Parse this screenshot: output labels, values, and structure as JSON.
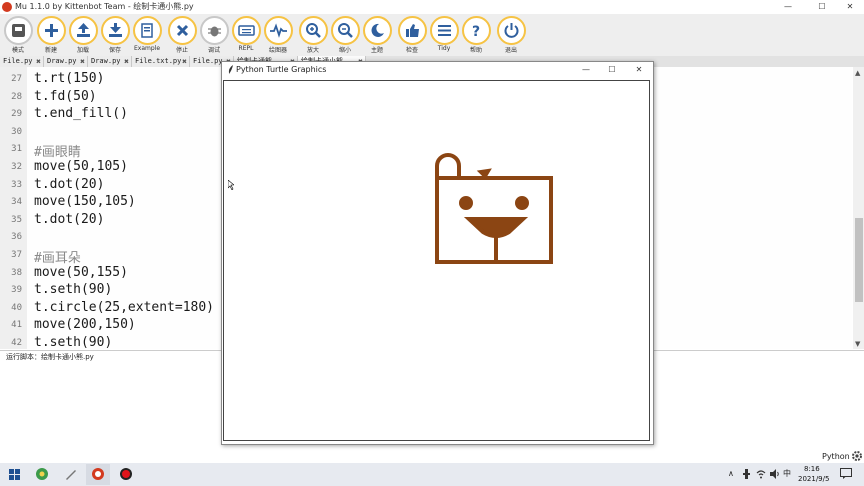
{
  "window": {
    "title": "Mu 1.1.0 by Kittenbot Team - 绘制卡通小熊.py",
    "minimize": "—",
    "maximize": "☐",
    "close": "✕"
  },
  "toolbar": [
    {
      "label": "模式",
      "icon": "mode-icon"
    },
    {
      "label": "新建",
      "icon": "plus-icon"
    },
    {
      "label": "加载",
      "icon": "upload-icon"
    },
    {
      "label": "保存",
      "icon": "download-icon"
    },
    {
      "label": "Example",
      "icon": "example-icon"
    },
    {
      "label": "停止",
      "icon": "stop-icon"
    },
    {
      "label": "调试",
      "icon": "bug-icon"
    },
    {
      "label": "REPL",
      "icon": "keyboard-icon"
    },
    {
      "label": "绘图器",
      "icon": "pulse-icon"
    },
    {
      "label": "放大",
      "icon": "zoom-in-icon"
    },
    {
      "label": "缩小",
      "icon": "zoom-out-icon"
    },
    {
      "label": "主题",
      "icon": "moon-icon"
    },
    {
      "label": "检查",
      "icon": "thumbs-up-icon"
    },
    {
      "label": "Tidy",
      "icon": "list-icon"
    },
    {
      "label": "帮助",
      "icon": "help-icon"
    },
    {
      "label": "退出",
      "icon": "power-icon"
    }
  ],
  "tabs": [
    {
      "label": "File.py"
    },
    {
      "label": "Draw.py"
    },
    {
      "label": "Draw.py"
    },
    {
      "label": "File.txt.py"
    },
    {
      "label": "File.py"
    },
    {
      "label": "绘制卡通熊"
    },
    {
      "label": "绘制卡通小熊"
    }
  ],
  "editor": {
    "lines": [
      {
        "n": "27",
        "text": "t.rt(150)",
        "comment": false
      },
      {
        "n": "28",
        "text": "t.fd(50)",
        "comment": false
      },
      {
        "n": "29",
        "text": "t.end_fill()",
        "comment": false
      },
      {
        "n": "30",
        "text": "",
        "comment": false
      },
      {
        "n": "31",
        "text": "#画眼睛",
        "comment": true
      },
      {
        "n": "32",
        "text": "move(50,105)",
        "comment": false
      },
      {
        "n": "33",
        "text": "t.dot(20)",
        "comment": false
      },
      {
        "n": "34",
        "text": "move(150,105)",
        "comment": false
      },
      {
        "n": "35",
        "text": "t.dot(20)",
        "comment": false
      },
      {
        "n": "36",
        "text": "",
        "comment": false
      },
      {
        "n": "37",
        "text": "#画耳朵",
        "comment": true
      },
      {
        "n": "38",
        "text": "move(50,155)",
        "comment": false
      },
      {
        "n": "39",
        "text": "t.seth(90)",
        "comment": false
      },
      {
        "n": "40",
        "text": "t.circle(25,extent=180)",
        "comment": false
      },
      {
        "n": "41",
        "text": "move(200,150)",
        "comment": false
      },
      {
        "n": "42",
        "text": "t.seth(90)",
        "comment": false
      }
    ]
  },
  "status": {
    "running_text": "运行脚本：绘制卡通小熊.py",
    "mode": "Python"
  },
  "turtle_window": {
    "title": "Python Turtle Graphics",
    "minimize": "—",
    "maximize": "☐",
    "close": "✕",
    "stroke_color": "#8b4513"
  },
  "taskbar": {
    "time": "8:16",
    "date": "2021/9/5",
    "ime": "中"
  }
}
